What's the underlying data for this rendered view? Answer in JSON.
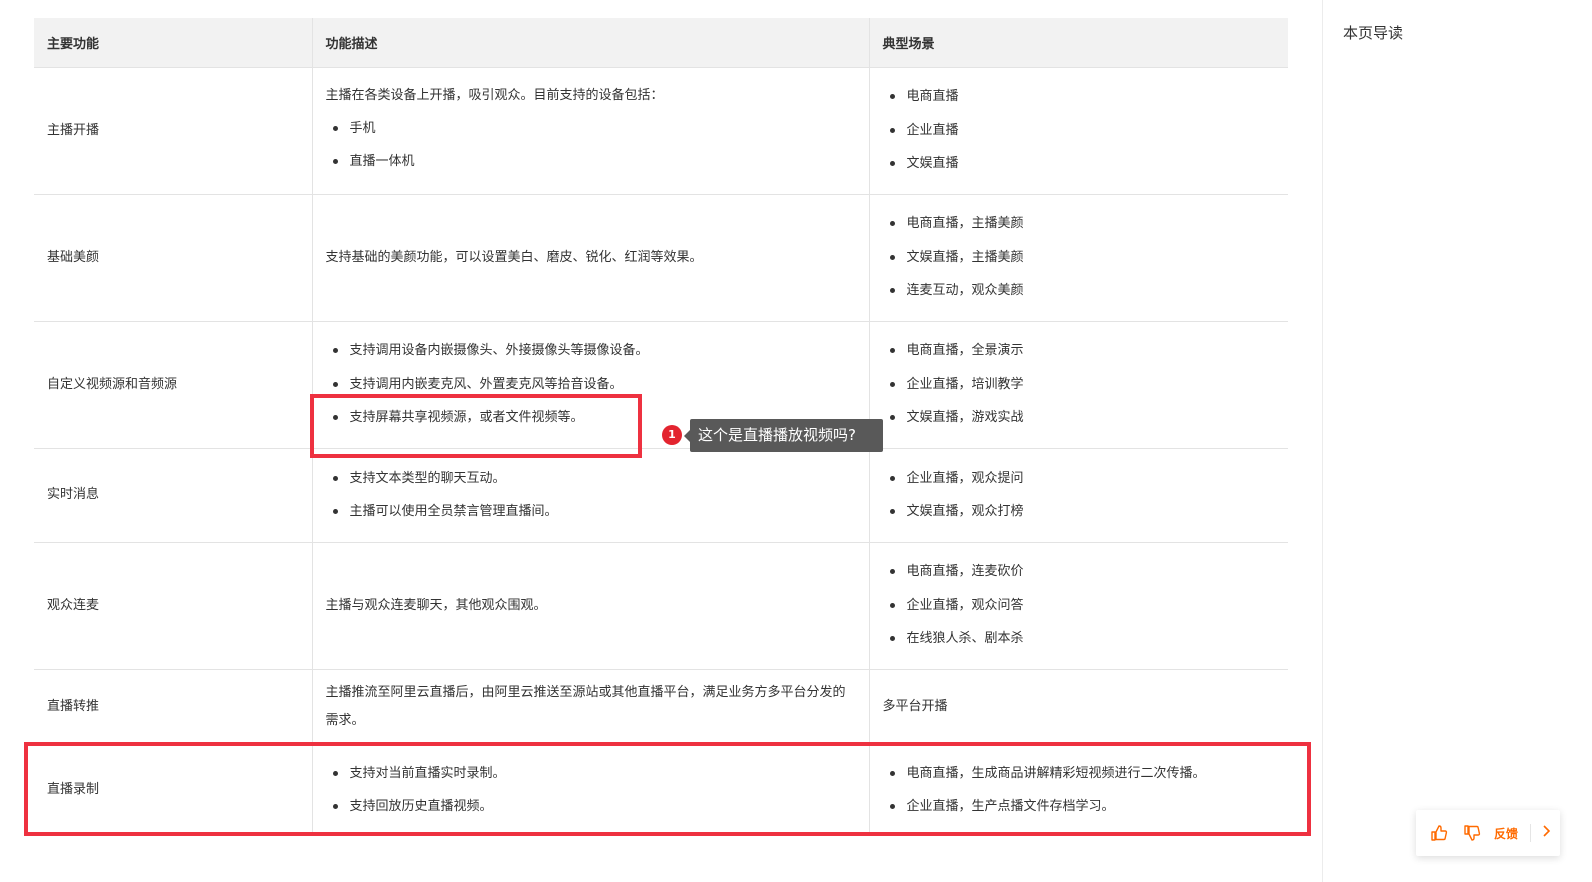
{
  "table": {
    "headers": [
      "主要功能",
      "功能描述",
      "典型场景"
    ],
    "rows": [
      {
        "feature": "主播开播",
        "desc_lead": "主播在各类设备上开播，吸引观众。目前支持的设备包括：",
        "desc_items": [
          "手机",
          "直播一体机"
        ],
        "scenes": [
          "电商直播",
          "企业直播",
          "文娱直播"
        ]
      },
      {
        "feature": "基础美颜",
        "desc_para": "支持基础的美颜功能，可以设置美白、磨皮、锐化、红润等效果。",
        "scenes": [
          "电商直播，主播美颜",
          "文娱直播，主播美颜",
          "连麦互动，观众美颜"
        ]
      },
      {
        "feature": "自定义视频源和音频源",
        "desc_items": [
          "支持调用设备内嵌摄像头、外接摄像头等摄像设备。",
          "支持调用内嵌麦克风、外置麦克风等拾音设备。",
          "支持屏幕共享视频源，或者文件视频等。"
        ],
        "scenes": [
          "电商直播，全景演示",
          "企业直播，培训教学",
          "文娱直播，游戏实战"
        ]
      },
      {
        "feature": "实时消息",
        "desc_items": [
          "支持文本类型的聊天互动。",
          "主播可以使用全员禁言管理直播间。"
        ],
        "scenes": [
          "企业直播，观众提问",
          "文娱直播，观众打榜"
        ]
      },
      {
        "feature": "观众连麦",
        "desc_para": "主播与观众连麦聊天，其他观众围观。",
        "scenes": [
          "电商直播，连麦砍价",
          "企业直播，观众问答",
          "在线狼人杀、剧本杀"
        ]
      },
      {
        "feature": "直播转推",
        "desc_para": "主播推流至阿里云直播后，由阿里云推送至源站或其他直播平台，满足业务方多平台分发的需求。",
        "scene_text": "多平台开播"
      },
      {
        "feature": "直播录制",
        "desc_items": [
          "支持对当前直播实时录制。",
          "支持回放历史直播视频。"
        ],
        "scenes": [
          "电商直播，生成商品讲解精彩短视频进行二次传播。",
          "企业直播，生产点播文件存档学习。"
        ]
      }
    ]
  },
  "annotation": {
    "marker": "1",
    "tooltip": "这个是直播播放视频吗?",
    "color": "#ee3140"
  },
  "sidebar": {
    "title": "本页导读"
  },
  "feedback": {
    "label": "反馈",
    "like_icon": "thumbs-up-icon",
    "dislike_icon": "thumbs-down-icon",
    "accent": "#ff6a00"
  }
}
